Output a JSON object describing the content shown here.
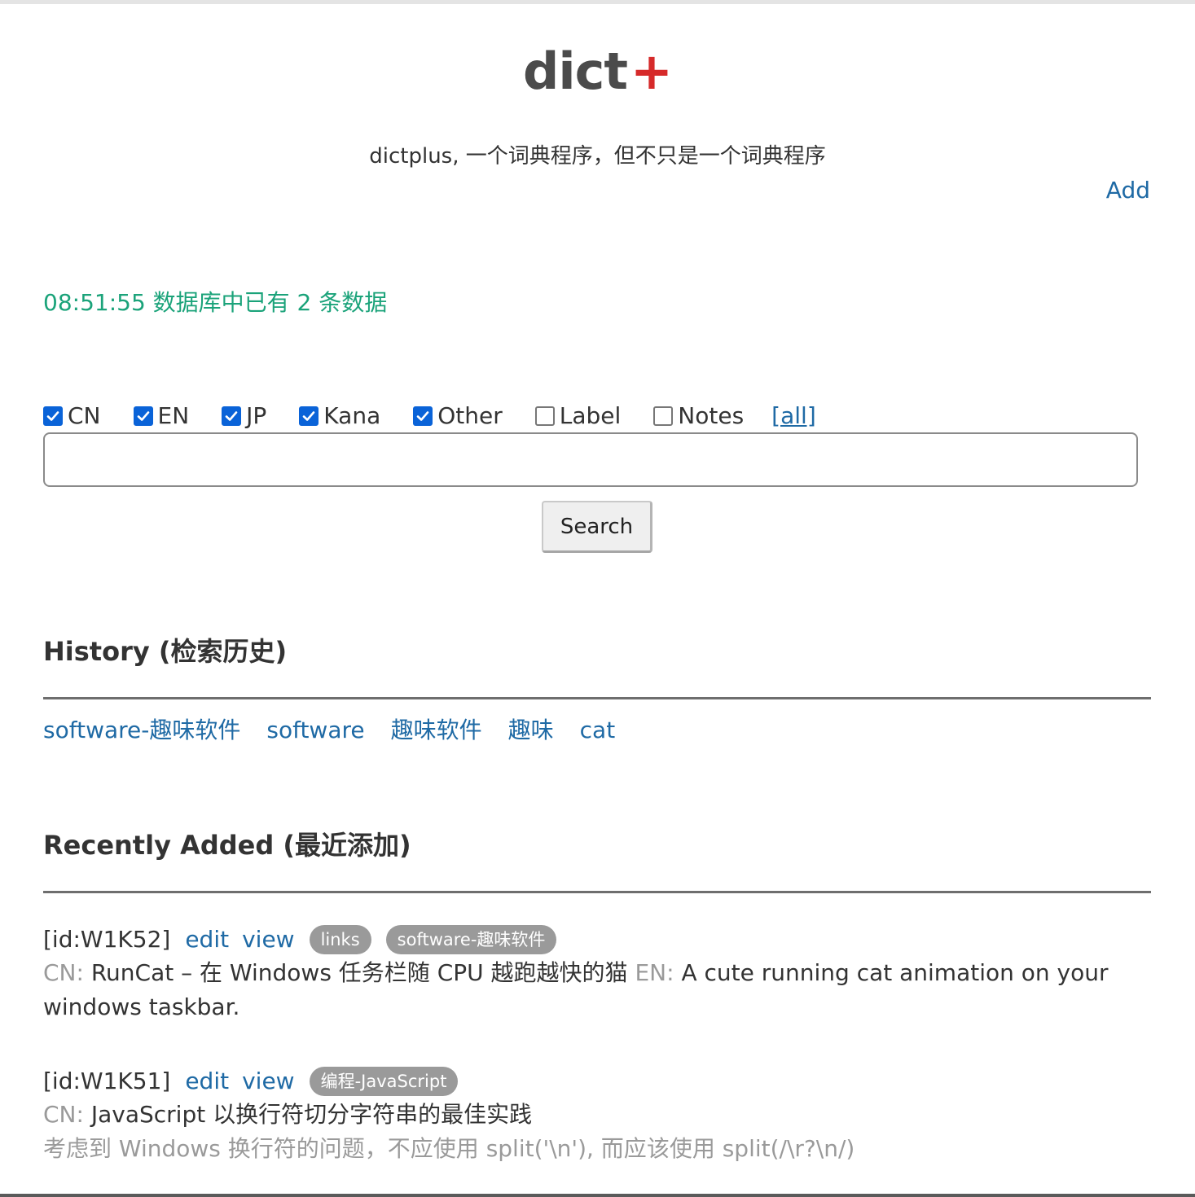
{
  "header": {
    "logo_text": "dict",
    "logo_plus": "+",
    "subtitle": "dictplus, 一个词典程序，但不只是一个词典程序",
    "add_label": "Add"
  },
  "status": {
    "text": "08:51:55 数据库中已有 2 条数据",
    "color": "#1ba37a"
  },
  "filters": {
    "options": [
      {
        "label": "CN",
        "checked": true
      },
      {
        "label": "EN",
        "checked": true
      },
      {
        "label": "JP",
        "checked": true
      },
      {
        "label": "Kana",
        "checked": true
      },
      {
        "label": "Other",
        "checked": true
      },
      {
        "label": "Label",
        "checked": false
      },
      {
        "label": "Notes",
        "checked": false
      }
    ],
    "all_label": "[all]"
  },
  "search": {
    "value": "",
    "placeholder": "",
    "button_label": "Search"
  },
  "history": {
    "title": "History (检索历史)",
    "items": [
      "software-趣味软件",
      "software",
      "趣味软件",
      "趣味",
      "cat"
    ]
  },
  "recent": {
    "title": "Recently Added (最近添加)",
    "entries": [
      {
        "id_text": "[id:W1K52]",
        "edit_label": "edit",
        "view_label": "view",
        "tags": [
          "links",
          "software-趣味软件"
        ],
        "cn_label": "CN:",
        "cn_text": "RunCat – 在 Windows 任务栏随 CPU 越跑越快的猫",
        "en_label": "EN:",
        "en_text": "A cute running cat animation on your windows taskbar."
      },
      {
        "id_text": "[id:W1K51]",
        "edit_label": "edit",
        "view_label": "view",
        "tags": [
          "编程-JavaScript"
        ],
        "cn_label": "CN:",
        "cn_text": "JavaScript 以换行符切分字符串的最佳实践",
        "notes_text": "考虑到 Windows 换行符的问题，不应使用 split('\\n'), 而应该使用 split(/\\r?\\n/)"
      }
    ]
  },
  "colors": {
    "link": "#1f6aa5",
    "accent_plus": "#d62a2a",
    "checkbox": "#0a63d8",
    "tag_bg": "#9a9a9a"
  }
}
